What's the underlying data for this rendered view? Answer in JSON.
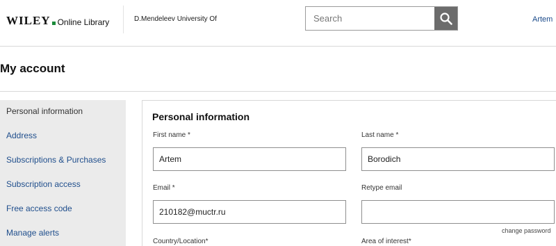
{
  "header": {
    "logo_wordmark": "WILEY",
    "logo_suffix": "Online Library",
    "institution": "D.Mendeleev University Of",
    "search_placeholder": "Search",
    "user_name": "Artem"
  },
  "page": {
    "title": "My account"
  },
  "sidebar": {
    "items": [
      {
        "label": "Personal information"
      },
      {
        "label": "Address"
      },
      {
        "label": "Subscriptions & Purchases"
      },
      {
        "label": "Subscription access"
      },
      {
        "label": "Free access code"
      },
      {
        "label": "Manage alerts"
      }
    ]
  },
  "form": {
    "section_title": "Personal information",
    "first_name": {
      "label": "First name *",
      "value": "Artem"
    },
    "last_name": {
      "label": "Last name *",
      "value": "Borodich"
    },
    "email": {
      "label": "Email *",
      "value": "210182@muctr.ru"
    },
    "retype_email": {
      "label": "Retype email",
      "value": ""
    },
    "change_password": "change password",
    "country": {
      "label": "Country/Location*"
    },
    "area_of_interest": {
      "label": "Area of interest*"
    }
  },
  "colors": {
    "link": "#1f4e8c",
    "sidebar_bg": "#ebebeb",
    "search_button": "#6c6c6c",
    "logo_accent": "#1b8a3a"
  }
}
